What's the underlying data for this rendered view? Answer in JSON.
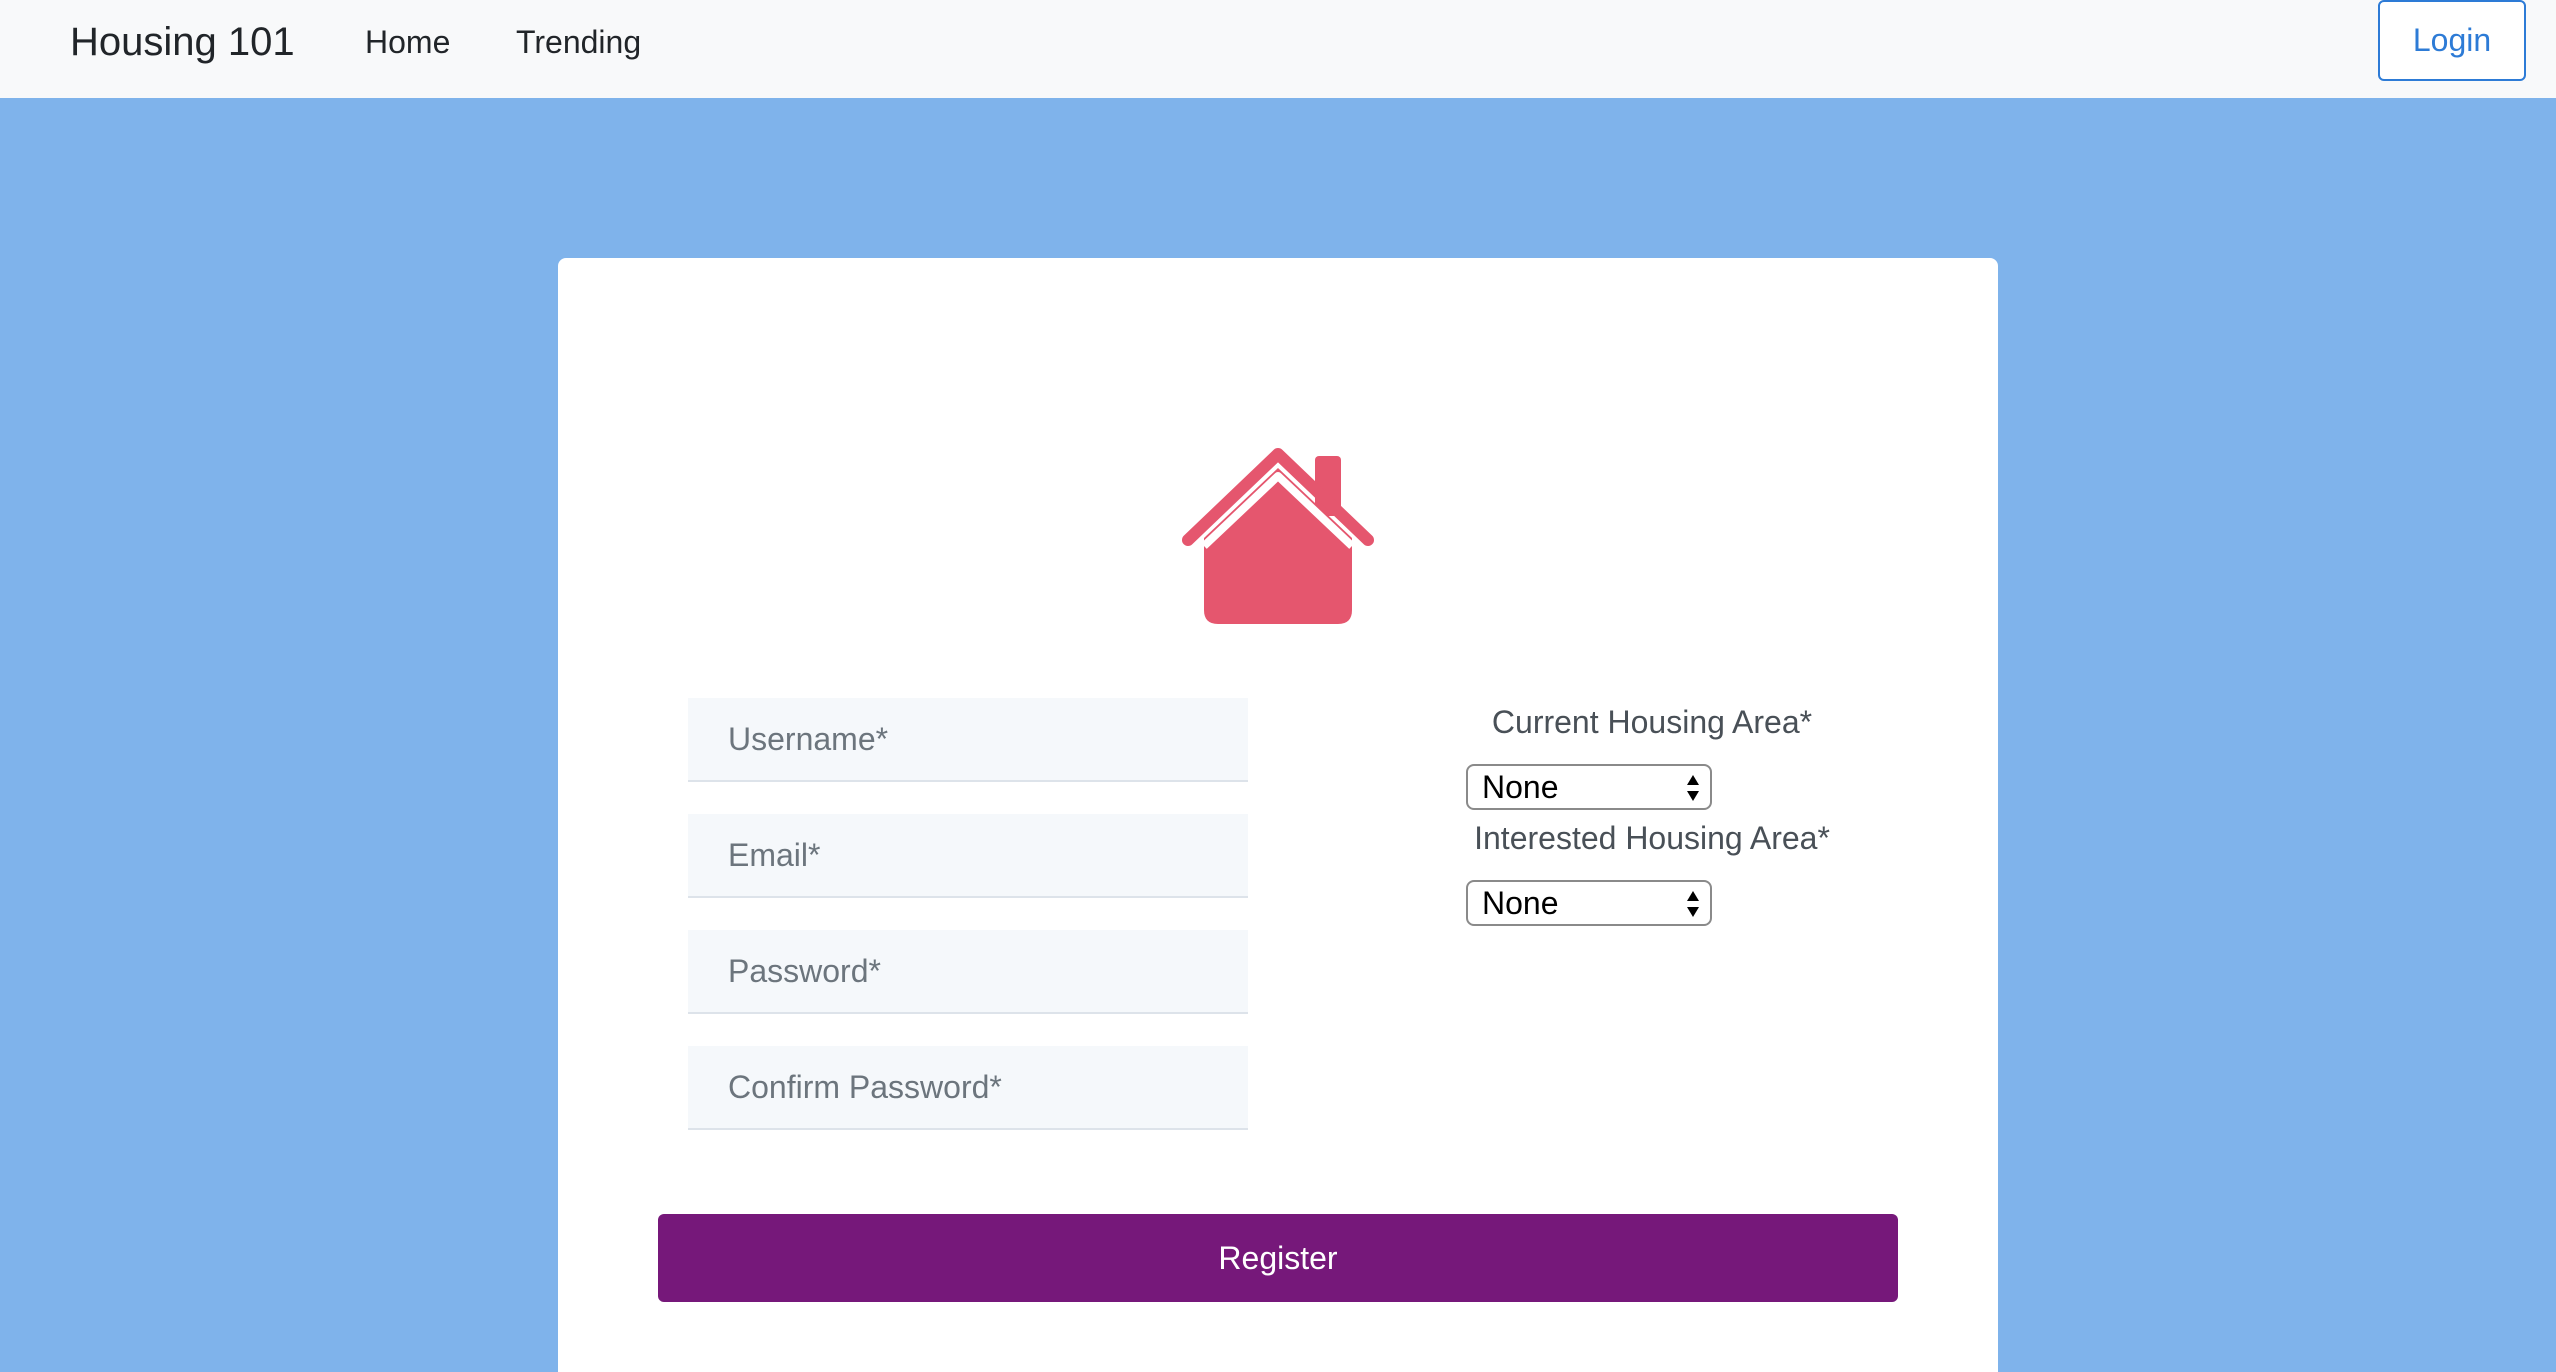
{
  "navbar": {
    "brand": "Housing 101",
    "links": [
      {
        "label": "Home"
      },
      {
        "label": "Trending"
      }
    ],
    "login_label": "Login"
  },
  "form": {
    "icon": "house-icon",
    "username_placeholder": "Username*",
    "email_placeholder": "Email*",
    "password_placeholder": "Password*",
    "confirm_password_placeholder": "Confirm Password*",
    "current_area_label": "Current Housing Area*",
    "current_area_value": "None",
    "interested_area_label": "Interested Housing Area*",
    "interested_area_value": "None",
    "register_label": "Register"
  },
  "colors": {
    "background": "#7fb3eb",
    "navbar": "#f8f9fa",
    "login_accent": "#2d7bd6",
    "house_icon": "#e5566e",
    "register_button": "#76187a"
  }
}
